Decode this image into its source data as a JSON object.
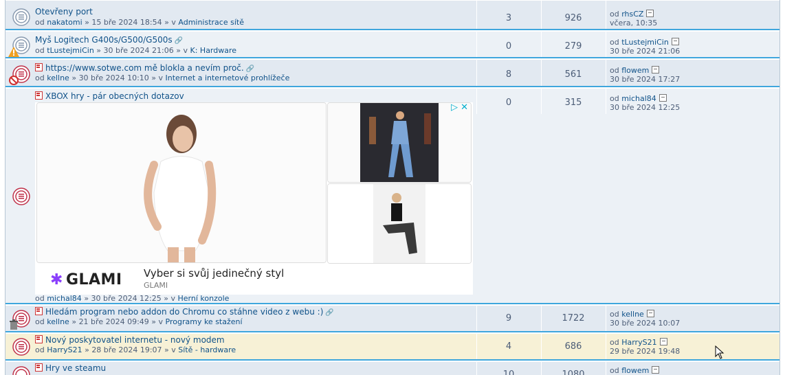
{
  "topics": [
    {
      "title": "Otevřeny port",
      "author": "nakatomi",
      "date": "15 bře 2024 18:54",
      "forum": "Administrace sítě",
      "replies": "3",
      "views": "926",
      "last_by": "rhsCZ",
      "last_time": "včera, 10:35",
      "attachment": false
    },
    {
      "title": "Myš Logitech G400s/G500/G500s",
      "author": "tLustejmiCin",
      "date": "30 bře 2024 21:06",
      "forum": "K: Hardware",
      "replies": "0",
      "views": "279",
      "last_by": "tLustejmiCin",
      "last_time": "30 bře 2024 21:06",
      "attachment": true
    },
    {
      "title": "https://www.sotwe.com mě bloklа a nevím proč.",
      "author": "kellne",
      "date": "30 bře 2024 10:10",
      "forum": "Internet a internetové prohlížeče",
      "replies": "8",
      "views": "561",
      "last_by": "flowem",
      "last_time": "30 bře 2024 17:27",
      "attachment": true
    },
    {
      "title": "XBOX hry - pár obecných dotazov",
      "author": "michal84",
      "date": "30 bře 2024 12:25",
      "forum": "Herní konzole",
      "replies": "0",
      "views": "315",
      "last_by": "michal84",
      "last_time": "30 bře 2024 12:25",
      "attachment": false
    },
    {
      "title": "Hledám program nebo addon do Chromu co stáhne video z webu :)",
      "author": "kellne",
      "date": "21 bře 2024 09:49",
      "forum": "Programy ke stažení",
      "replies": "9",
      "views": "1722",
      "last_by": "kellne",
      "last_time": "30 bře 2024 10:07",
      "attachment": true
    },
    {
      "title": "Nový poskytovatel internetu - nový modem",
      "author": "HarryS21",
      "date": "28 bře 2024 19:07",
      "forum": "Sítě - hardware",
      "replies": "4",
      "views": "686",
      "last_by": "HarryS21",
      "last_time": "29 bře 2024 19:48",
      "attachment": false
    },
    {
      "title": "Hry ve steamu",
      "replies": "10",
      "views": "1080",
      "last_by": "flowem"
    }
  ],
  "labels": {
    "by": "od",
    "in": "v",
    "sep": "»"
  },
  "ad": {
    "brand_logo": "GLAMI",
    "headline": "Vyber si svůj jedinečný styl",
    "brand": "GLAMI",
    "choices_icon": "adchoices-icon",
    "close_icon": "close-icon"
  },
  "colors": {
    "link": "#105289",
    "row_bg": "#e2e9f1",
    "row_alt": "#ecf1f6",
    "highlight": "#f7f1d6",
    "separator": "#3ea6dd",
    "icon_ring": "#c0334b",
    "glami": "#8a3ffc"
  }
}
